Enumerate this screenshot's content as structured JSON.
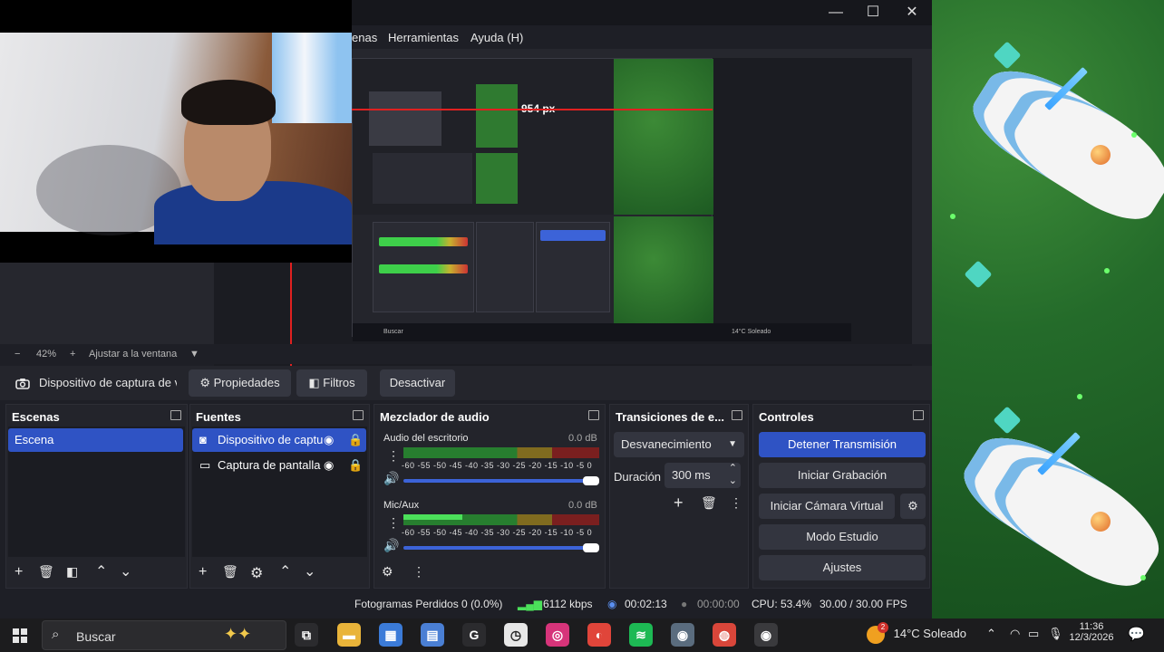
{
  "window": {
    "minimize_glyph": "—",
    "maximize_glyph": "☐",
    "close_glyph": "✕"
  },
  "menu": {
    "items": [
      "enas",
      "Herramientas",
      "Ayuda (H)"
    ]
  },
  "preview": {
    "nested_measure_label": "954 px",
    "inner_taskbar_search": "Buscar",
    "inner_weather": "14°C Soleado",
    "inner_status": "Fotogramas Perdidos 0 (0.0%)   6112 kbps   00:02:13   00:00:00   CPU: 53.4%   30.00 / 30.00 FPS"
  },
  "zoom": {
    "minus": "−",
    "value": "42%",
    "plus": "+",
    "fit_label": "Ajustar a la ventana",
    "dropdown_glyph": "▼"
  },
  "source_toolbar": {
    "source_name": "Dispositivo de captura de v",
    "properties_label": "Propiedades",
    "filters_label": "Filtros",
    "deactivate_label": "Desactivar"
  },
  "scenes": {
    "title": "Escenas",
    "items": [
      "Escena"
    ]
  },
  "sources": {
    "title": "Fuentes",
    "items": [
      "Dispositivo de captu",
      "Captura de pantalla"
    ]
  },
  "mixer": {
    "title": "Mezclador de audio",
    "ticks": "-60 -55 -50 -45 -40 -35 -30 -25 -20 -15 -10 -5 0",
    "channels": [
      {
        "name": "Audio del escritorio",
        "db": "0.0 dB",
        "level": 0.0
      },
      {
        "name": "Mic/Aux",
        "db": "0.0 dB",
        "level": 0.3
      }
    ]
  },
  "transitions": {
    "title": "Transiciones de e...",
    "selected": "Desvanecimiento",
    "duration_label": "Duración",
    "duration_value": "300 ms"
  },
  "controls": {
    "title": "Controles",
    "stop_stream": "Detener Transmisión",
    "start_recording": "Iniciar Grabación",
    "start_virtual_cam": "Iniciar Cámara Virtual",
    "studio_mode": "Modo Estudio",
    "settings": "Ajustes"
  },
  "status": {
    "dropped_frames": "Fotogramas Perdidos 0 (0.0%)",
    "bitrate": "6112 kbps",
    "stream_time": "00:02:13",
    "record_time": "00:00:00",
    "cpu": "CPU: 53.4%",
    "fps": "30.00 / 30.00 FPS"
  },
  "taskbar": {
    "search_label": "Buscar",
    "weather_badge": "2",
    "weather": "14°C  Soleado",
    "time": "11:36",
    "date": "12/3/2026",
    "apps": [
      {
        "name": "task-view",
        "glyph": "⧉",
        "color": "#2b2b2e"
      },
      {
        "name": "file-explorer",
        "glyph": "▬",
        "color": "#e9b43a"
      },
      {
        "name": "ms-store",
        "glyph": "▦",
        "color": "#3b7bd8"
      },
      {
        "name": "calculator",
        "glyph": "▤",
        "color": "#4a7fd4"
      },
      {
        "name": "google",
        "glyph": "G",
        "color": "#2b2b2e"
      },
      {
        "name": "clock",
        "glyph": "◷",
        "color": "#e7e7e7"
      },
      {
        "name": "instagram",
        "glyph": "◎",
        "color": "#d6347a"
      },
      {
        "name": "capcut",
        "glyph": "◐",
        "color": "#e0453a"
      },
      {
        "name": "spotify",
        "glyph": "≋",
        "color": "#1db954"
      },
      {
        "name": "camera",
        "glyph": "◉",
        "color": "#5a6c7e"
      },
      {
        "name": "chrome",
        "glyph": "◍",
        "color": "#d9463a"
      },
      {
        "name": "obs",
        "glyph": "◉",
        "color": "#3a3a3d"
      }
    ]
  },
  "colors": {
    "accent": "#2f53c4",
    "meter_green": "#4be05a",
    "window_bg": "#1e1f26"
  }
}
